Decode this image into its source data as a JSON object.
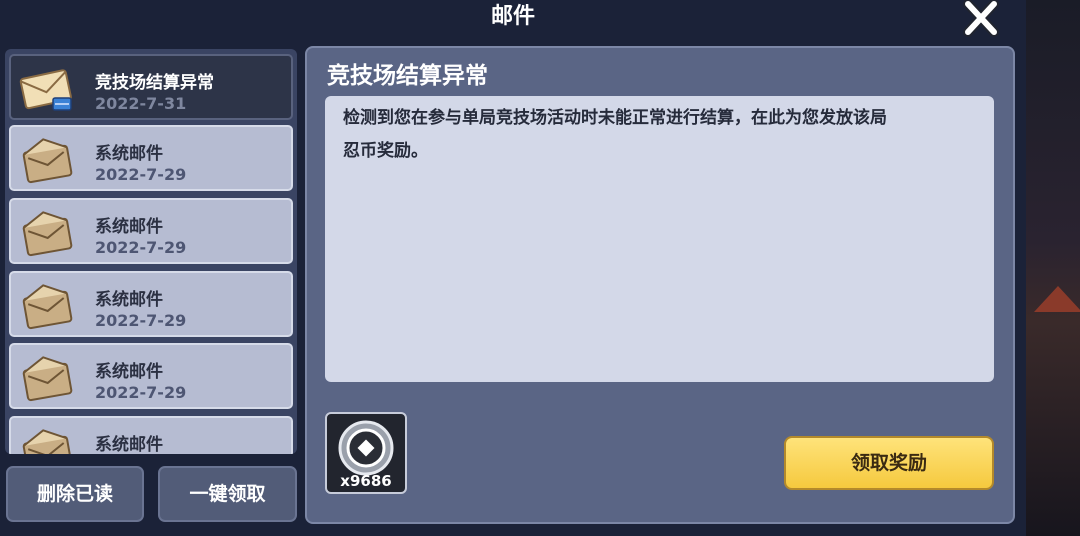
{
  "window": {
    "title": "邮件"
  },
  "mail_list": [
    {
      "name": "竞技场结算异常",
      "date": "2022-7-31",
      "selected": true
    },
    {
      "name": "系统邮件",
      "date": "2022-7-29",
      "selected": false
    },
    {
      "name": "系统邮件",
      "date": "2022-7-29",
      "selected": false
    },
    {
      "name": "系统邮件",
      "date": "2022-7-29",
      "selected": false
    },
    {
      "name": "系统邮件",
      "date": "2022-7-29",
      "selected": false
    },
    {
      "name": "系统邮件",
      "date": "",
      "selected": false
    }
  ],
  "list_actions": {
    "delete_read": "删除已读",
    "claim_all": "一键领取"
  },
  "detail": {
    "title": "竞技场结算异常",
    "line1": "检测到您在参与单局竞技场活动时未能正常进行结算，在此为您发放该局",
    "line2": "忍币奖励。",
    "reward": {
      "icon": "ninja-coin-icon",
      "count": "x9686"
    },
    "claim_label": "领取奖励"
  },
  "colors": {
    "claim_button": "#f5c93e",
    "selected_item": "#2d3448",
    "item": "#b6bcd2"
  }
}
